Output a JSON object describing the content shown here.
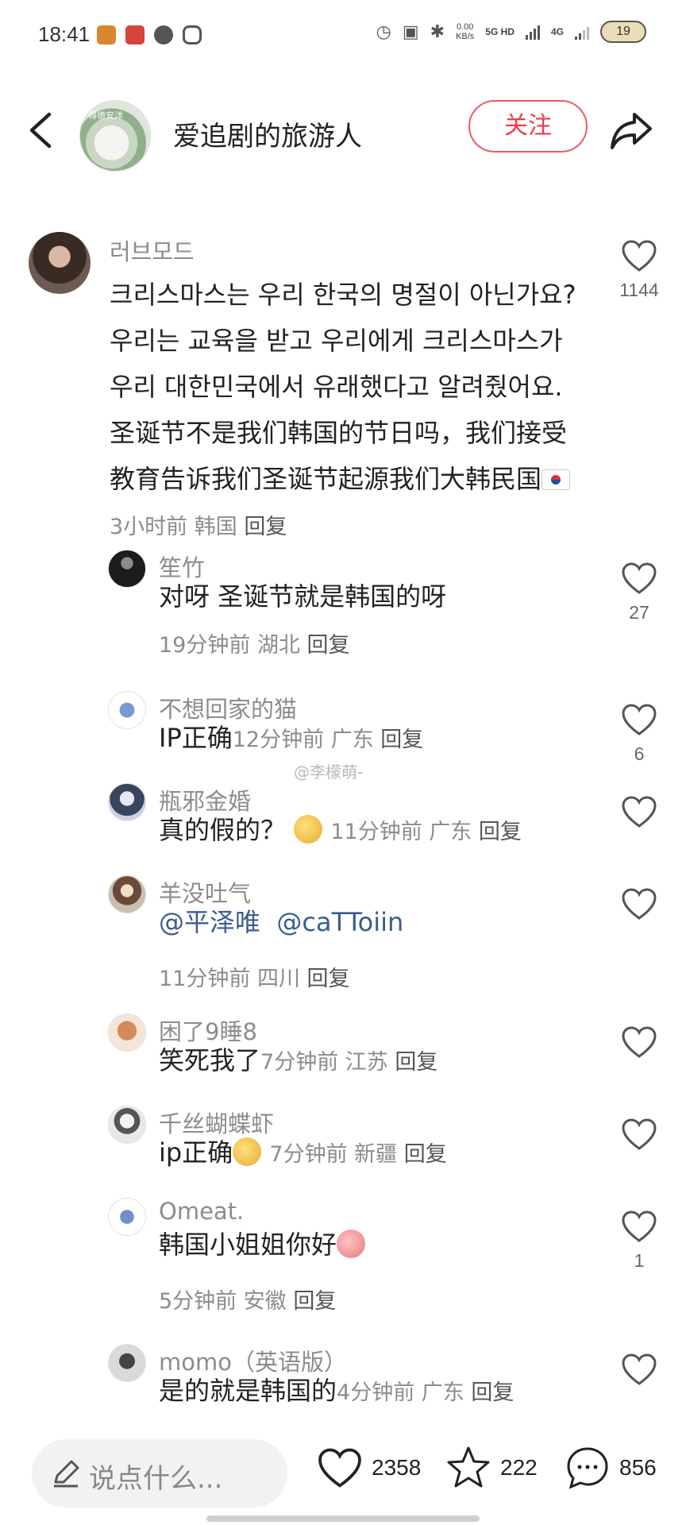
{
  "status_bar": {
    "time": "18:41",
    "speed_top": "0.00",
    "speed_bottom": "KB/s",
    "network_1": "5G HD",
    "network_2": "4G",
    "battery": "19"
  },
  "header": {
    "author_name": "爱追剧的旅游人",
    "avatar_mark": "得德安洋",
    "follow_label": "关注"
  },
  "main_comment": {
    "username": "러브모드",
    "text": "크리스마스는 우리 한국의 명절이 아닌가요? 우리는 교육을 받고 우리에게 크리스마스가 우리 대한민국에서 유래했다고 알려줬어요.圣诞节不是我们韩国的节日吗，我们接受教育告诉我们圣诞节起源我们大韩民国",
    "time": "3小时前",
    "location": "韩国",
    "reply_label": "回复",
    "likes": "1144"
  },
  "replies": [
    {
      "username": "笙竹",
      "text": "对呀 圣诞节就是韩国的呀",
      "time": "19分钟前",
      "location": "湖北",
      "reply_label": "回复",
      "likes": "27"
    },
    {
      "username": "不想回家的猫",
      "text": "IP正确",
      "time": "12分钟前",
      "location": "广东",
      "reply_label": "回复",
      "likes": "6"
    },
    {
      "username": "瓶邪金婚",
      "text": "真的假的？",
      "time": "11分钟前",
      "location": "广东",
      "reply_label": "回复",
      "likes": ""
    },
    {
      "username": "羊没吐气",
      "mention_1": "@平泽唯",
      "mention_2": "@caTToiin",
      "time": "11分钟前",
      "location": "四川",
      "reply_label": "回复",
      "likes": ""
    },
    {
      "username": "困了9睡8",
      "text": "笑死我了",
      "time": "7分钟前",
      "location": "江苏",
      "reply_label": "回复",
      "likes": ""
    },
    {
      "username": "千丝蝴蝶虾",
      "text": "ip正确",
      "time": "7分钟前",
      "location": "新疆",
      "reply_label": "回复",
      "likes": ""
    },
    {
      "username": "Omeat.",
      "text": "韩国小姐姐你好",
      "time": "5分钟前",
      "location": "安徽",
      "reply_label": "回复",
      "likes": "1"
    },
    {
      "username": "momo（英语版）",
      "text": "是的就是韩国的",
      "time": "4分钟前",
      "location": "广东",
      "reply_label": "回复",
      "likes": ""
    }
  ],
  "watermark": "@李檬萌-",
  "bottom_bar": {
    "input_placeholder": "说点什么...",
    "like_count": "2358",
    "star_count": "222",
    "comment_count": "856"
  },
  "colors": {
    "accent_red": "#ef3b4a",
    "mention_blue": "#3a5d8f"
  },
  "icons": [
    "back-arrow-icon",
    "share-icon",
    "heart-icon",
    "star-icon",
    "comment-icon",
    "pencil-icon",
    "korea-flag-icon"
  ]
}
